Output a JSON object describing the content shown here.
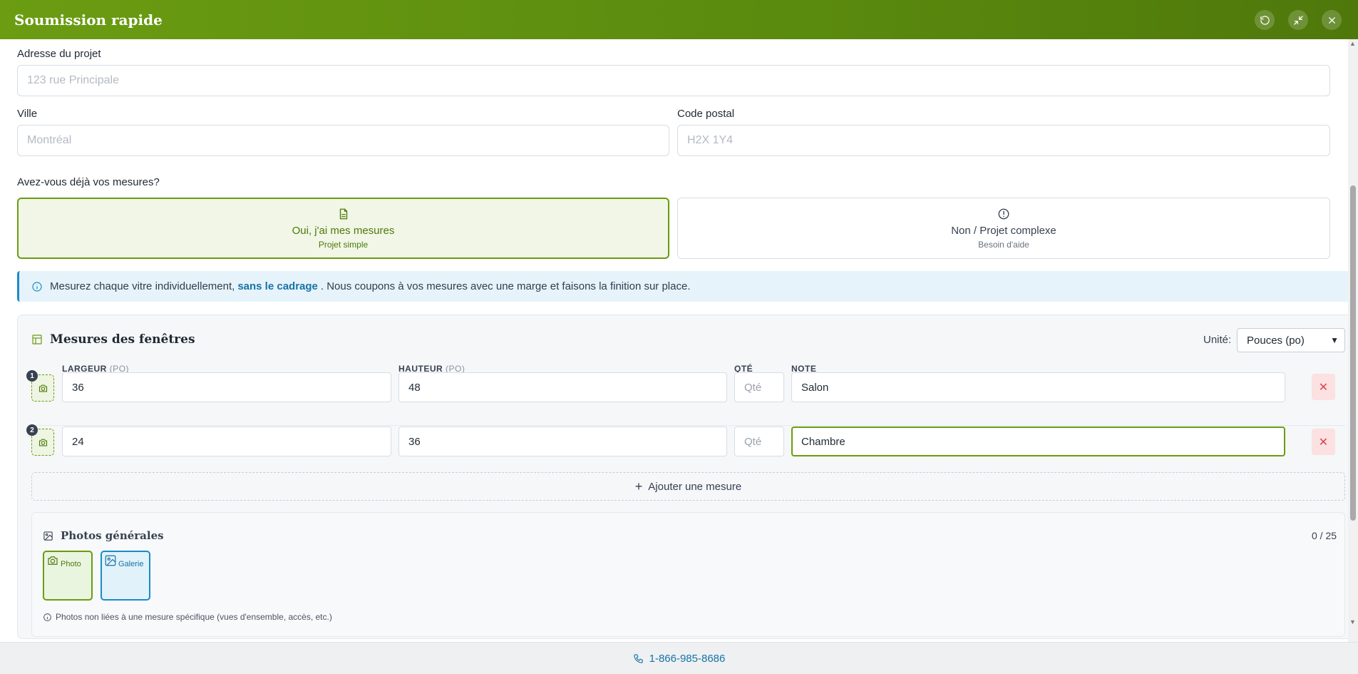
{
  "header": {
    "title": "Soumission rapide",
    "buttons": [
      "refresh-icon",
      "minimize-icon",
      "close-icon"
    ]
  },
  "form": {
    "address_label": "Adresse du projet",
    "address_placeholder": "123 rue Principale",
    "city_label": "Ville",
    "city_placeholder": "Montréal",
    "postal_label": "Code postal",
    "postal_placeholder": "H2X 1Y4"
  },
  "measures_question": "Avez-vous déjà vos mesures?",
  "choices": [
    {
      "title": "Oui, j'ai mes mesures",
      "subtitle": "Projet simple",
      "icon": "document-icon",
      "selected": true
    },
    {
      "title": "Non / Projet complexe",
      "subtitle": "Besoin d'aide",
      "icon": "alert-circle-icon",
      "selected": false
    }
  ],
  "info": {
    "before": "Mesurez chaque vitre individuellement,",
    "bold": "sans le cadrage",
    "after": ". Nous coupons à vos mesures avec une marge et faisons la finition sur place."
  },
  "measurements": {
    "title": "Mesures des fenêtres",
    "unit_label": "Unité:",
    "unit_value": "Pouces (po)",
    "columns": {
      "width": "LARGEUR",
      "width_unit": "(PO)",
      "height": "HAUTEUR",
      "height_unit": "(PO)",
      "qty": "QTÉ",
      "note": "NOTE"
    },
    "qty_placeholder": "Qté",
    "rows": [
      {
        "num": "1",
        "width": "36",
        "height": "48",
        "note": "Salon"
      },
      {
        "num": "2",
        "width": "24",
        "height": "36",
        "note": "Chambre"
      }
    ],
    "add_label": "Ajouter une mesure"
  },
  "photos": {
    "title": "Photos générales",
    "count": "0 / 25",
    "photo_label": "Photo",
    "gallery_label": "Galerie",
    "note": "Photos non liées à une mesure spécifique (vues d'ensemble, accès, etc.)"
  },
  "footer": {
    "phone": "1-866-985-8686"
  },
  "colors": {
    "brand_green": "#6b9c12",
    "accent_blue": "#1b8cc7",
    "danger": "#e0434b"
  }
}
